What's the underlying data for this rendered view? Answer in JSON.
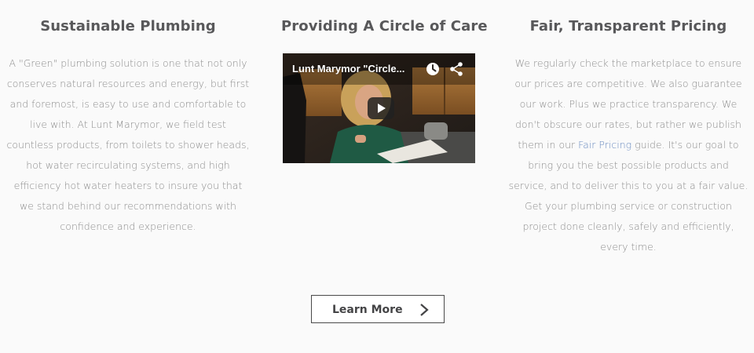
{
  "columns": {
    "left": {
      "heading": "Sustainable Plumbing",
      "body": "A \"Green\" plumbing solution is one that not only conserves natural resources and energy, but first and foremost, is easy to use and comfortable to live with. At Lunt Marymor, we field test countless products, from toilets to shower heads, hot water recirculating systems, and high efficiency hot water heaters to insure you that we stand behind our recommendations with confidence and experience."
    },
    "middle": {
      "heading": "Providing A Circle of Care",
      "video": {
        "title": "Lunt Marymor \"Circle...",
        "icons": [
          "watch-later-icon",
          "share-icon",
          "play-icon"
        ]
      }
    },
    "right": {
      "heading": "Fair, Transparent Pricing",
      "body_before_link": "We regularly check the marketplace to ensure our prices are competitive. We also guarantee our work. Plus we practice transparency. We don't obscure our rates, but rather we publish them in our ",
      "link_text": "Fair Pricing",
      "body_after_link": " guide. It's our goal to bring you the best possible products and service, and to deliver this to you at a fair value. Get your plumbing service or construction project done cleanly, safely and efficiently, every time."
    }
  },
  "cta": {
    "label": "Learn More",
    "icon": "chevron-right-icon"
  },
  "colors": {
    "heading": "#58585a",
    "body": "#8d8d8d",
    "link": "#6b8cc0",
    "background": "#fafafa",
    "button_border": "#4a4a4a"
  }
}
